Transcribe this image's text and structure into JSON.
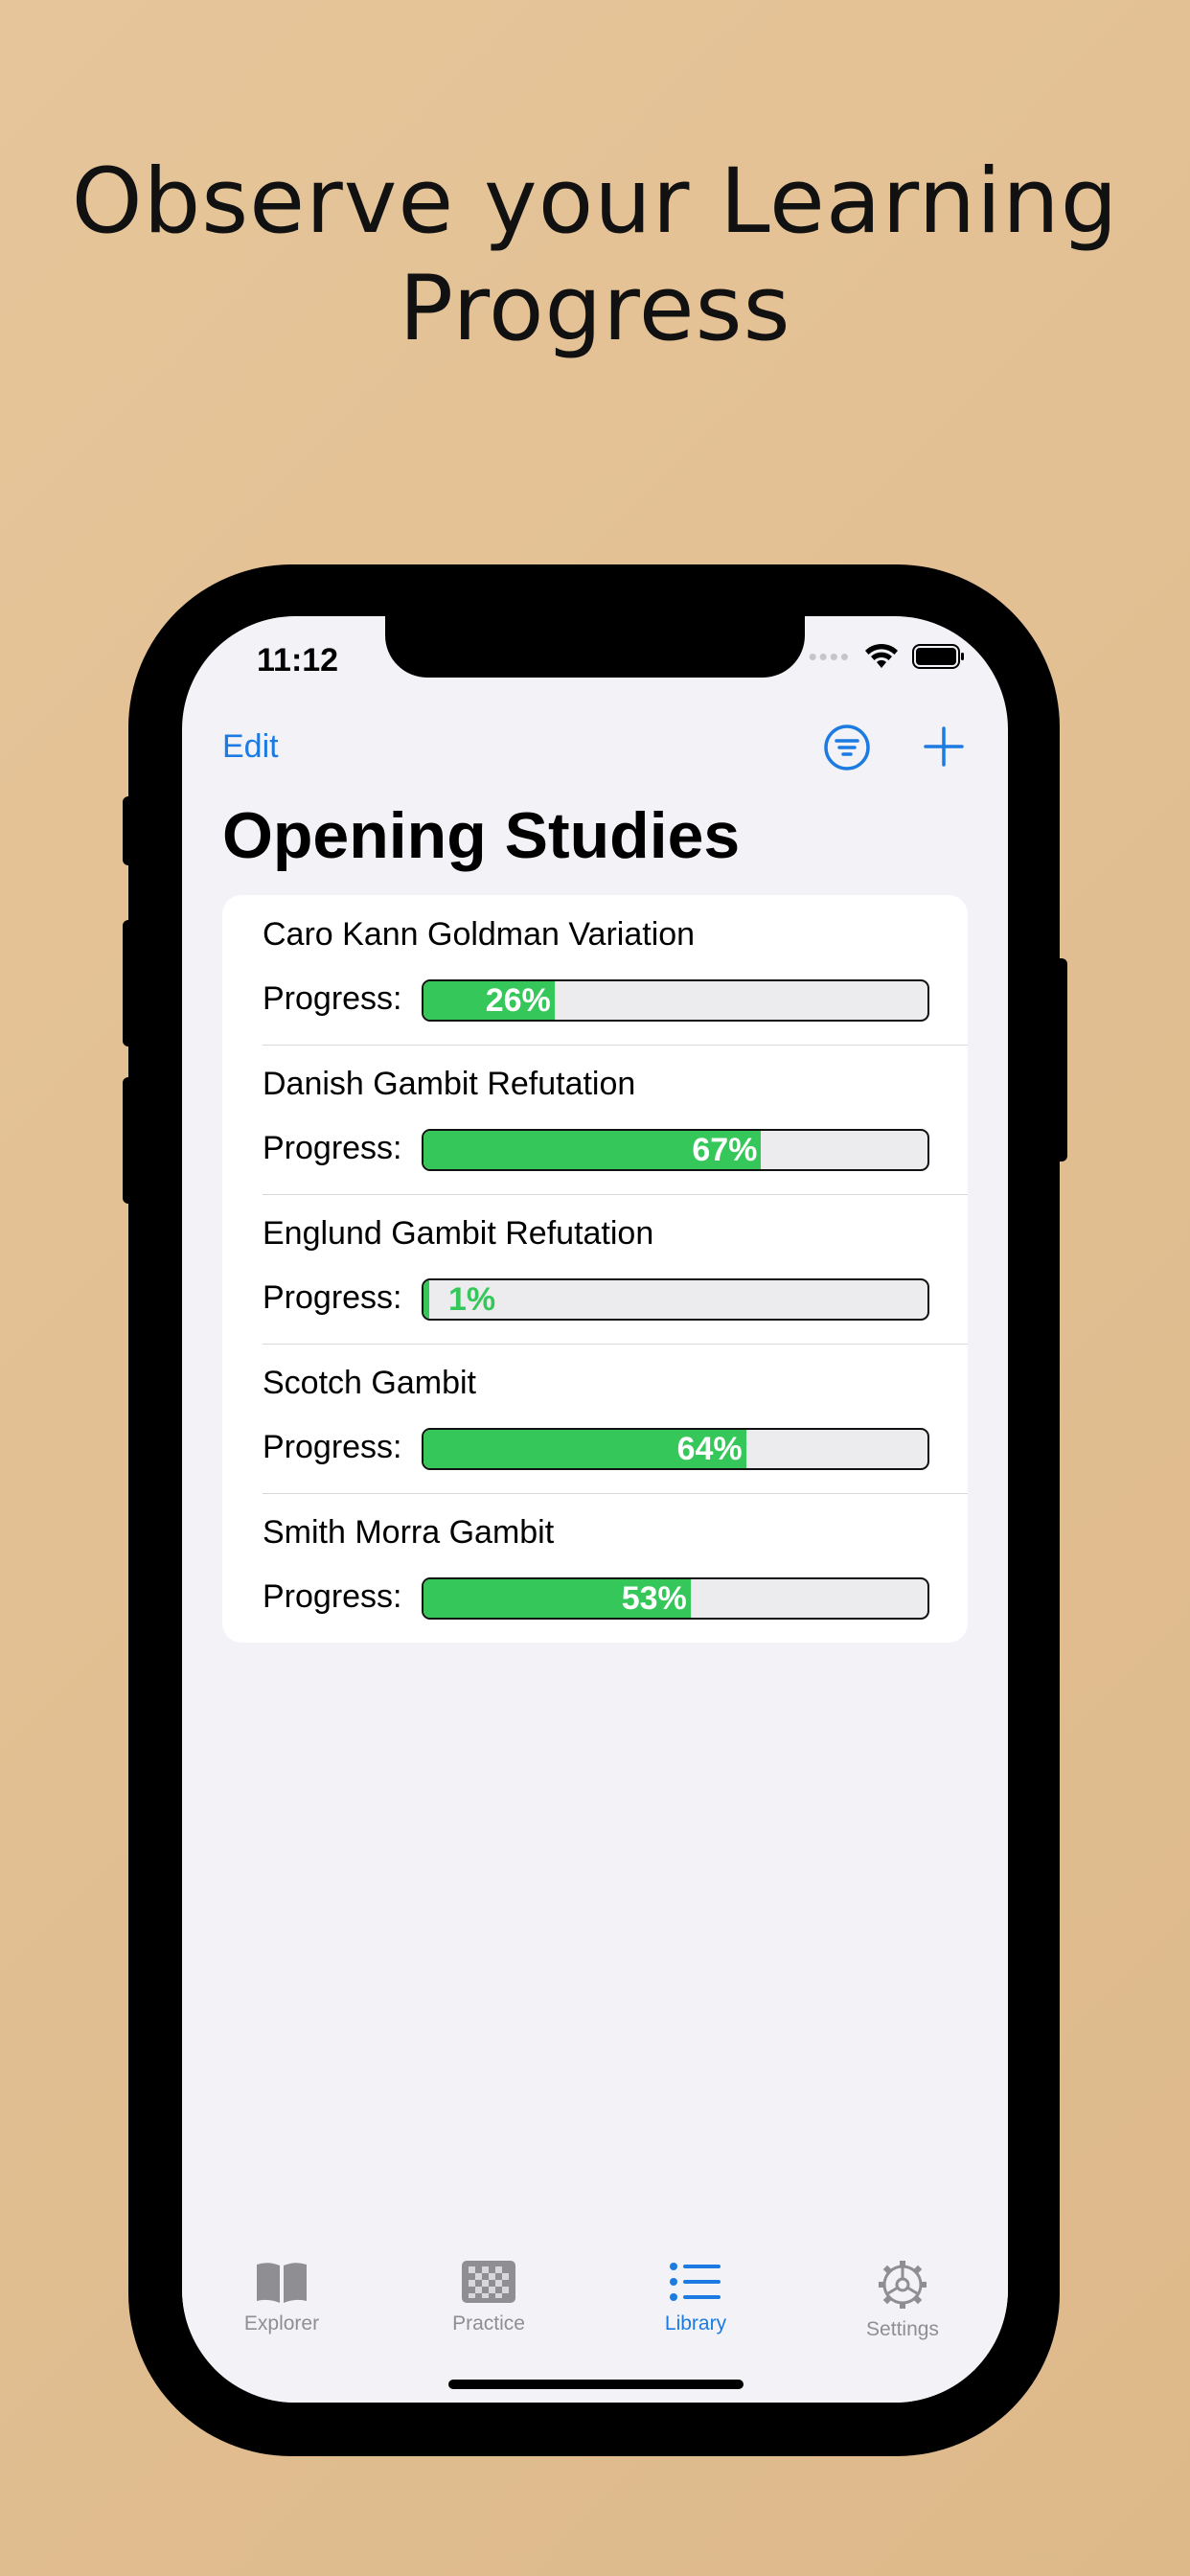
{
  "headline": "Observe your Learning Progress",
  "status_bar": {
    "time": "11:12"
  },
  "nav": {
    "edit_label": "Edit"
  },
  "title": "Opening Studies",
  "progress_label": "Progress:",
  "studies": [
    {
      "name": "Caro Kann Goldman Variation",
      "progress": 26,
      "progress_text": "26%"
    },
    {
      "name": "Danish Gambit Refutation",
      "progress": 67,
      "progress_text": "67%"
    },
    {
      "name": "Englund Gambit Refutation",
      "progress": 1,
      "progress_text": "1%"
    },
    {
      "name": "Scotch Gambit",
      "progress": 64,
      "progress_text": "64%"
    },
    {
      "name": "Smith Morra Gambit",
      "progress": 53,
      "progress_text": "53%"
    }
  ],
  "tabs": [
    {
      "label": "Explorer",
      "icon": "book-icon",
      "active": false
    },
    {
      "label": "Practice",
      "icon": "chessboard-icon",
      "active": false
    },
    {
      "label": "Library",
      "icon": "list-icon",
      "active": true
    },
    {
      "label": "Settings",
      "icon": "gear-icon",
      "active": false
    }
  ],
  "colors": {
    "accent": "#1c7be2",
    "progress_fill": "#35c759",
    "progress_track": "#ececee",
    "inactive_tab": "#8e8e93"
  }
}
